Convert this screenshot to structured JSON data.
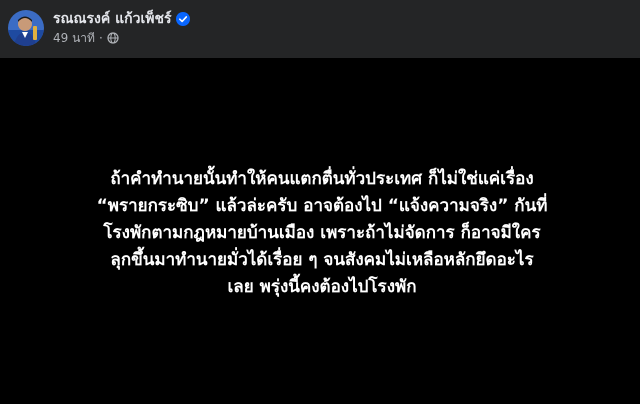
{
  "post": {
    "author_name": "รณณรงค์ แก้วเพ็ชร์",
    "verified": true,
    "timestamp": "49 นาที",
    "separator": "·",
    "audience_icon": "globe-icon",
    "verified_icon": "verified-badge-icon",
    "text_background": "#000000",
    "text": "ถ้าคำทำนายนั้นทำให้คนแตกตื่นทั่วประเทศ ก็ไม่ใช่แค่เรื่อง\n“พรายกระซิบ” แล้วล่ะครับ อาจต้องไป “แจ้งความจริง” กันที่\nโรงพักตามกฎหมายบ้านเมือง เพราะถ้าไม่จัดการ ก็อาจมีใคร\nลุกขึ้นมาทำนายมั่วได้เรื่อย ๆ จนสังคมไม่เหลือหลักยึดอะไร\nเลย พรุ่งนี้คงต้องไปโรงพัก"
  },
  "colors": {
    "page_bg": "#242526",
    "primary_text": "#e4e6eb",
    "secondary_text": "#b0b3b8",
    "verified_blue": "#0866ff"
  }
}
